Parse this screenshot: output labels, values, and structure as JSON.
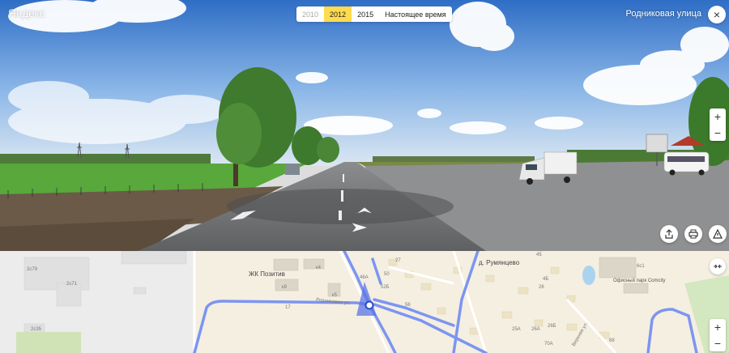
{
  "logo": {
    "text": "Яндекс"
  },
  "years": [
    {
      "label": "2010",
      "state": "disabled"
    },
    {
      "label": "2012",
      "state": "selected"
    },
    {
      "label": "2015",
      "state": "normal"
    },
    {
      "label": "Настоящее время",
      "state": "normal"
    }
  ],
  "street_name": "Родниковая улица",
  "icons": {
    "close": "×",
    "zoom_in": "+",
    "zoom_out": "−",
    "share": "share-icon",
    "print": "print-icon",
    "report": "warning-icon",
    "expand": "expand-icon"
  },
  "map": {
    "labels": {
      "zhk": "ЖК Позитив",
      "village": "д. Румянцево",
      "office": "Офисный парк Comcity",
      "street": "Родниковая ул.",
      "street2": "Верхняя ул.",
      "b_2c79": "2с79",
      "b_2c71": "2с71",
      "b_2c35": "2с35",
      "b_k4": "к4",
      "b_k9": "к9",
      "b_k5": "к5",
      "b_27": "27",
      "b_46a": "46А",
      "b_50": "50",
      "b_52b": "52Б",
      "b_56": "56",
      "b_4b": "4Б",
      "b_26": "26",
      "b_25a": "25А",
      "b_26a": "26А",
      "b_26b": "26Б",
      "b_17": "17",
      "b_6c1": "6с1",
      "b_45": "45",
      "b_68": "68",
      "b_70a": "70А"
    }
  },
  "colors": {
    "year_selected": "#ffdb4d",
    "route": "#7c95f2",
    "map_bg": "#f5efe1"
  }
}
